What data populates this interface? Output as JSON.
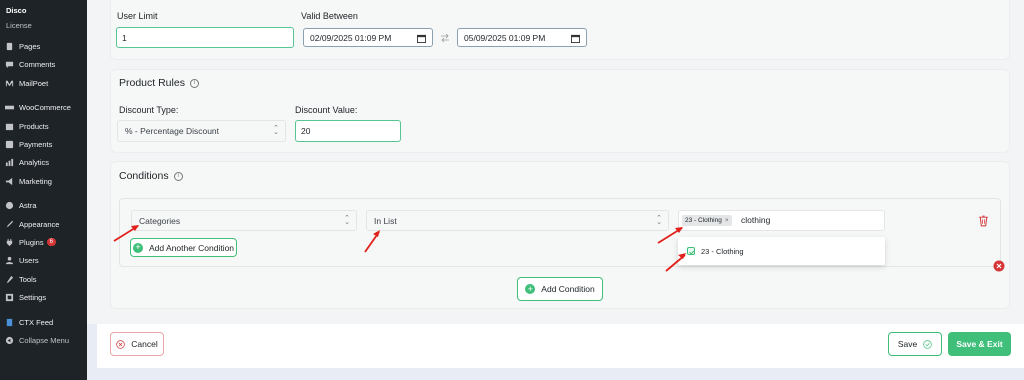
{
  "sidebar": {
    "title": "Disco",
    "subtitle": "License",
    "items": [
      {
        "label": "Pages",
        "icon": "pages-icon"
      },
      {
        "label": "Comments",
        "icon": "comments-icon"
      },
      {
        "label": "MailPoet",
        "icon": "mailpoet-icon"
      },
      {
        "label": "WooCommerce",
        "icon": "woocommerce-icon"
      },
      {
        "label": "Products",
        "icon": "products-icon"
      },
      {
        "label": "Payments",
        "icon": "payments-icon"
      },
      {
        "label": "Analytics",
        "icon": "analytics-icon"
      },
      {
        "label": "Marketing",
        "icon": "marketing-icon"
      },
      {
        "label": "Astra",
        "icon": "astra-icon"
      },
      {
        "label": "Appearance",
        "icon": "appearance-icon"
      },
      {
        "label": "Plugins",
        "icon": "plugins-icon",
        "badge": "6"
      },
      {
        "label": "Users",
        "icon": "users-icon"
      },
      {
        "label": "Tools",
        "icon": "tools-icon"
      },
      {
        "label": "Settings",
        "icon": "settings-icon"
      },
      {
        "label": "CTX Feed",
        "icon": "ctx-feed-icon"
      },
      {
        "label": "Collapse Menu",
        "icon": "collapse-icon"
      }
    ]
  },
  "limits": {
    "user_limit_label": "User Limit",
    "user_limit_value": "1",
    "valid_between_label": "Valid Between",
    "start_datetime": "02/09/2025 01:09 PM",
    "end_datetime": "05/09/2025 01:09 PM"
  },
  "product_rules": {
    "title": "Product Rules",
    "discount_type_label": "Discount Type:",
    "discount_type_value": "% - Percentage Discount",
    "discount_value_label": "Discount Value:",
    "discount_value": "20"
  },
  "conditions": {
    "title": "Conditions",
    "field_value": "Categories",
    "operator_value": "In List",
    "selected_tag": "23 - Clothing",
    "tag_remove": "×",
    "search_text": "clothing",
    "dropdown_option": "23 - Clothing",
    "add_another_label": "Add Another Condition",
    "add_condition_label": "Add Condition"
  },
  "footer": {
    "cancel_label": "Cancel",
    "save_label": "Save",
    "save_exit_label": "Save & Exit"
  },
  "colors": {
    "sidebar_bg": "#1d2327",
    "accent_green": "#3fbf7a",
    "danger_red": "#d63638",
    "annotation_red": "#e0201a"
  }
}
